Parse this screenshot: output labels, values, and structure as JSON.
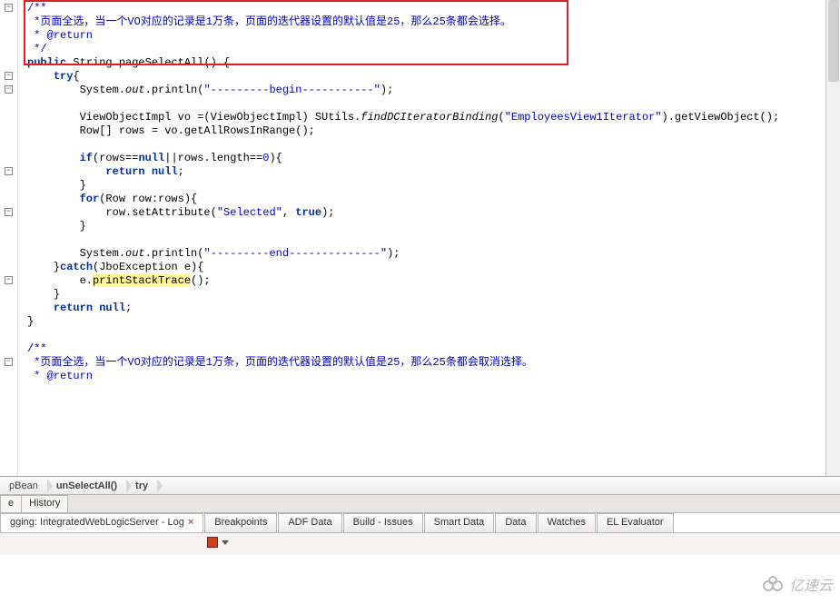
{
  "code": {
    "l01": "/**",
    "l02": " *页面全选，当一个VO对应的记录是1万条，页面的迭代器设置的默认值是25，那么25条都会选择。",
    "l03": " * @return",
    "l04": " */",
    "l05_pre": "public",
    "l05_mid": " String pageSelectAll() {",
    "l06_pre": "    try{",
    "l07_pre": "        System.",
    "l07_out": "out",
    "l07_mid": ".println(",
    "l07_str": "\"---------begin-----------\"",
    "l07_end": ");",
    "l08": " ",
    "l09_pre": "        ViewObjectImpl vo =(ViewObjectImpl) SUtils.",
    "l09_fn": "findDCIteratorBinding",
    "l09_mid": "(",
    "l09_str": "\"EmployeesView1Iterator\"",
    "l09_end": ").getViewObject();",
    "l10_pre": "        Row[] rows = vo.getAllRowsInRange();",
    "l11": " ",
    "l12_pre": "        if(rows==",
    "l12_n1": "null",
    "l12_mid": "||rows.length==",
    "l12_z": "0",
    "l12_end": "){",
    "l13_pre": "            return ",
    "l13_n": "null",
    "l13_end": ";",
    "l14": "        }",
    "l15_pre": "        for(Row row:rows){",
    "l16_pre": "            row.setAttribute(",
    "l16_s1": "\"Selected\"",
    "l16_c": ", ",
    "l16_s2": "true",
    "l16_end": ");",
    "l17": "        }",
    "l18": " ",
    "l19_pre": "        System.",
    "l19_out": "out",
    "l19_mid": ".println(",
    "l19_str": "\"---------end--------------\"",
    "l19_end": ");",
    "l20_pre": "    }catch(JboException e){",
    "l21_pre": "        e.",
    "l21_fn": "printStackTrace",
    "l21_end": "();",
    "l22": "    }",
    "l23_pre": "    return ",
    "l23_n": "null",
    "l23_end": ";",
    "l24": "}",
    "l25": " ",
    "l26": "/**",
    "l27": " *页面全选，当一个VO对应的记录是1万条，页面的迭代器设置的默认值是25，那么25条都会取消选择。",
    "l28": " * @return"
  },
  "breadcrumb": {
    "c1": "pBean",
    "c2": "unSelectAll()",
    "c3": "try"
  },
  "editorTabs": {
    "t1": "e",
    "t2": "History"
  },
  "bottomTabs": {
    "t1_prefix": "gging: IntegratedWebLogicServer - Log",
    "t2": "Breakpoints",
    "t3": "ADF Data",
    "t4": "Build - Issues",
    "t5": "Smart Data",
    "t6": "Data",
    "t7": "Watches",
    "t8": "EL Evaluator"
  },
  "watermark": "亿速云"
}
